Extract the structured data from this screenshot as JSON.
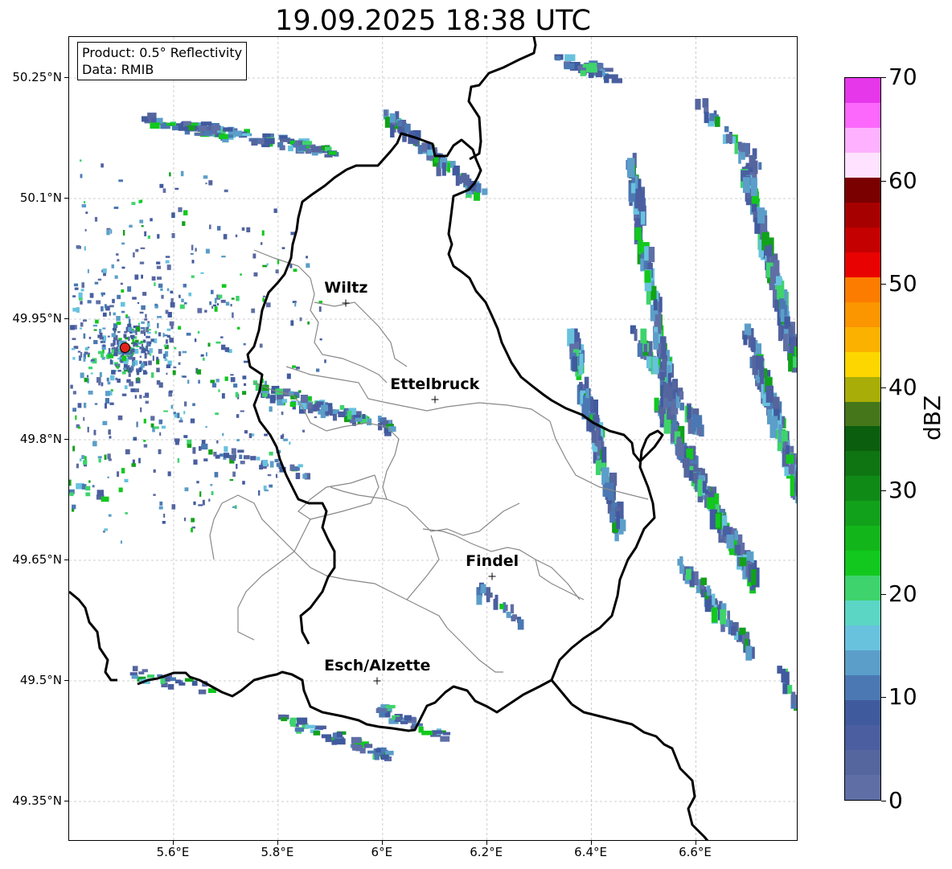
{
  "title": "19.09.2025 18:38 UTC",
  "info": {
    "product": "Product: 0.5° Reflectivity",
    "data": "Data: RMIB"
  },
  "lat_ticks": [
    "50.25°N",
    "50.1°N",
    "49.95°N",
    "49.8°N",
    "49.65°N",
    "49.5°N",
    "49.35°N"
  ],
  "lon_ticks": [
    "5.6°E",
    "5.8°E",
    "6°E",
    "6.2°E",
    "6.4°E",
    "6.6°E"
  ],
  "cities": [
    {
      "name": "Wiltz",
      "lon": 5.93,
      "lat": 49.97
    },
    {
      "name": "Ettelbruck",
      "lon": 6.1,
      "lat": 49.85
    },
    {
      "name": "Findel",
      "lon": 6.21,
      "lat": 49.63
    },
    {
      "name": "Esch/Alzette",
      "lon": 5.99,
      "lat": 49.5
    }
  ],
  "colorbar": {
    "unit": "dBZ",
    "labels": [
      "0",
      "10",
      "20",
      "30",
      "40",
      "50",
      "60",
      "70"
    ],
    "colors": [
      "#5f6fa6",
      "#55659e",
      "#4a5ea0",
      "#405a9e",
      "#4b78b2",
      "#5b9ec9",
      "#68c2de",
      "#5cd6c4",
      "#3ed36c",
      "#12c81e",
      "#12b61a",
      "#12a11a",
      "#0f8a17",
      "#0e7512",
      "#0b5e0d",
      "#45771a",
      "#a8ad07",
      "#fdd600",
      "#fbb100",
      "#fb9500",
      "#fc7c00",
      "#e80202",
      "#c40000",
      "#a70000",
      "#7a0000",
      "#ffe2ff",
      "#fdb1ff",
      "#fc68fb",
      "#e637ea"
    ]
  },
  "legend_colors": {
    "border": "#000000",
    "district_line": "#888888",
    "grid": "#c0c0c0",
    "radar_site": "#e2231a"
  }
}
